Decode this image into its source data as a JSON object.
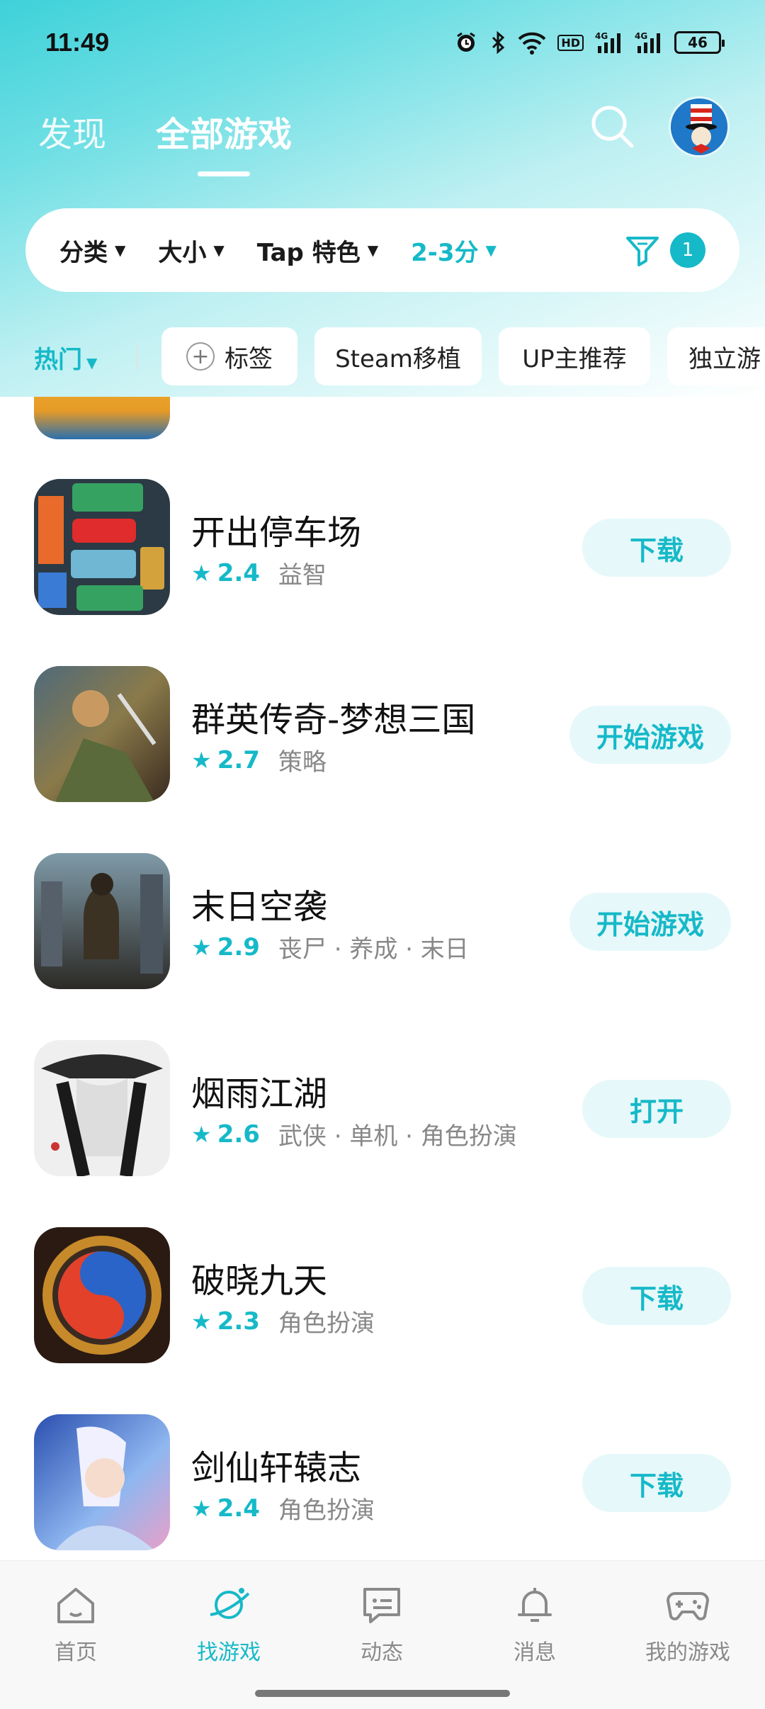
{
  "status_bar": {
    "time": "11:49",
    "network": "4G",
    "hd": "HD",
    "battery": "46"
  },
  "top_nav": {
    "tabs": [
      {
        "label": "发现"
      },
      {
        "label": "全部游戏"
      }
    ]
  },
  "filters": {
    "items": [
      {
        "label": "分类"
      },
      {
        "label": "大小"
      },
      {
        "label": "Tap 特色"
      },
      {
        "label": "2-3分"
      }
    ],
    "badge_count": "1"
  },
  "tags": {
    "hot": "热门",
    "items": [
      {
        "label": "标签"
      },
      {
        "label": "Steam移植"
      },
      {
        "label": "UP主推荐"
      },
      {
        "label": "独立游"
      }
    ]
  },
  "games": [
    {
      "name": "开出停车场",
      "score": "2.4",
      "tags": "益智",
      "action": "下载"
    },
    {
      "name": "群英传奇-梦想三国",
      "score": "2.7",
      "tags": "策略",
      "action": "开始游戏"
    },
    {
      "name": "末日空袭",
      "score": "2.9",
      "tags": "丧尸 · 养成 · 末日",
      "action": "开始游戏"
    },
    {
      "name": "烟雨江湖",
      "score": "2.6",
      "tags": "武侠 · 单机 · 角色扮演",
      "action": "打开"
    },
    {
      "name": "破晓九天",
      "score": "2.3",
      "tags": "角色扮演",
      "action": "下载"
    },
    {
      "name": "剑仙轩辕志",
      "score": "2.4",
      "tags": "角色扮演",
      "action": "下载"
    }
  ],
  "bottom_nav": {
    "items": [
      {
        "label": "首页"
      },
      {
        "label": "找游戏"
      },
      {
        "label": "动态"
      },
      {
        "label": "消息"
      },
      {
        "label": "我的游戏"
      }
    ]
  },
  "colors": {
    "accent": "#16b9c8",
    "header_gradient_start": "#3ed1d9",
    "button_bg": "#e6f8fa"
  }
}
